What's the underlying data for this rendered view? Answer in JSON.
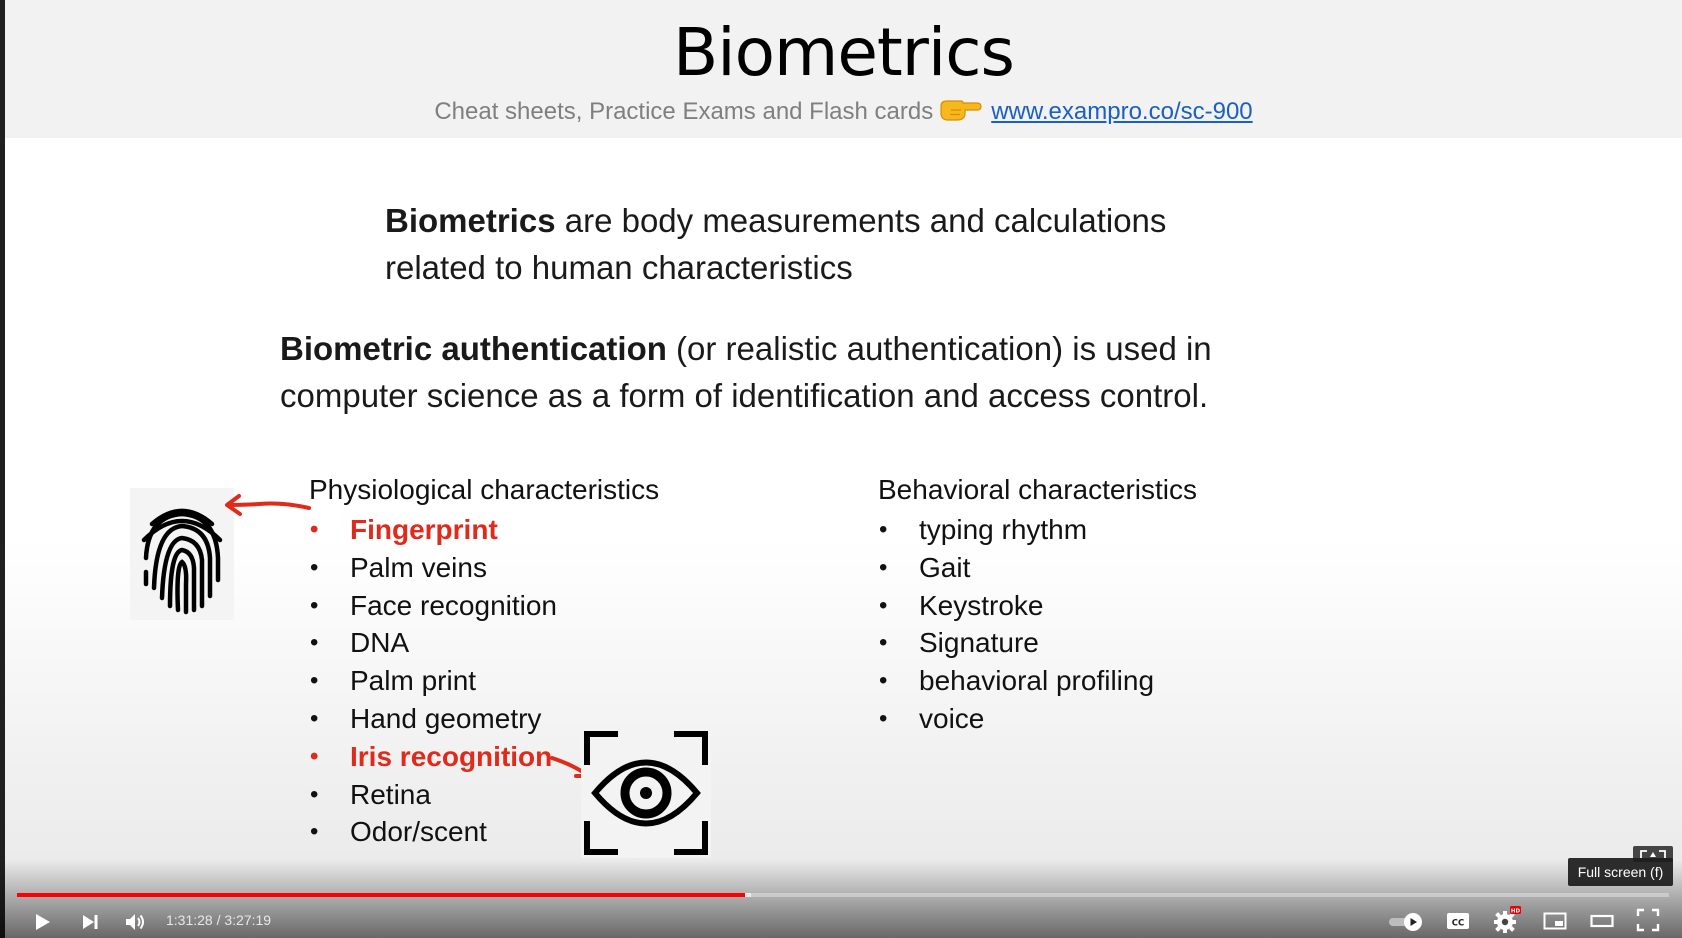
{
  "slide": {
    "title": "Biometrics",
    "subtitle_text": "Cheat sheets, Practice Exams and Flash cards",
    "subtitle_link": "www.exampro.co/sc-900",
    "para1_bold": "Biometrics",
    "para1_rest": " are body measurements and calculations related to human characteristics",
    "para2_bold": "Biometric authentication",
    "para2_rest": " (or realistic authentication) is used in computer science as a form of identification and access control.",
    "physiological": {
      "header": "Physiological characteristics",
      "items": [
        "Fingerprint",
        "Palm veins",
        "Face recognition",
        "DNA",
        "Palm print",
        "Hand geometry",
        "Iris recognition",
        "Retina",
        "Odor/scent"
      ],
      "highlighted": [
        "Fingerprint",
        "Iris recognition"
      ]
    },
    "behavioral": {
      "header": "Behavioral characteristics",
      "items": [
        "typing rhythm",
        "Gait",
        "Keystroke",
        "Signature",
        "behavioral profiling",
        "voice"
      ]
    },
    "bullet": "•",
    "highlight_color": "#e02a1b",
    "link_color": "#1a5fc4"
  },
  "player": {
    "time_display": "1:31:28 / 3:27:19",
    "progress_fraction": 0.4407,
    "tooltip": "Full screen (f)",
    "hd_badge": "HD",
    "accent_color": "#ff0000"
  }
}
